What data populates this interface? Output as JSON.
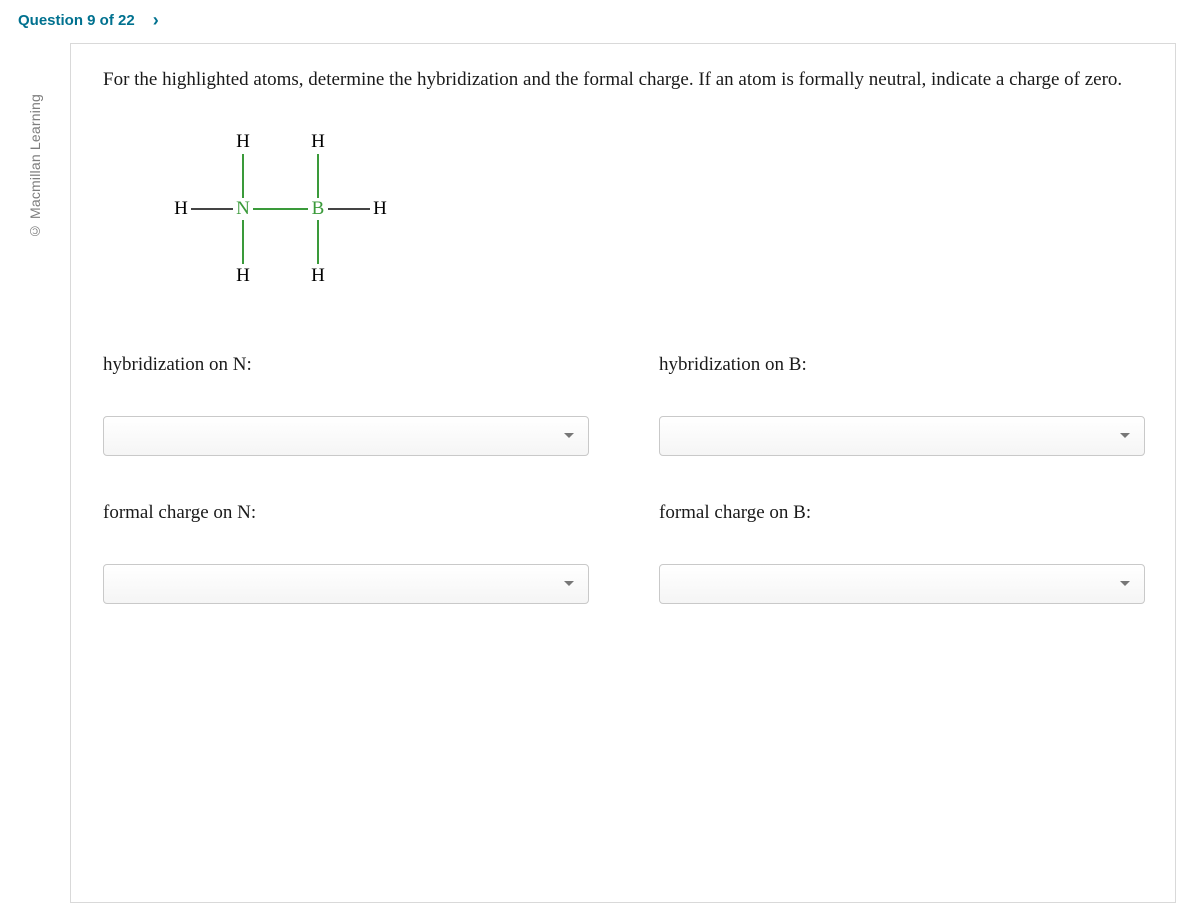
{
  "header": {
    "question_label": "Question 9 of 22",
    "chevron": "›"
  },
  "copyright": "© Macmillan Learning",
  "prompt": "For the highlighted atoms, determine the hybridization and the formal charge. If an atom is formally neutral, indicate a charge of zero.",
  "molecule": {
    "atoms": {
      "H_left": "H",
      "H_topN": "H",
      "H_botN": "H",
      "N_center": "N",
      "B_center": "B",
      "H_topB": "H",
      "H_botB": "H",
      "H_right": "H"
    }
  },
  "fields": {
    "hybN": {
      "label": "hybridization on N:",
      "value": ""
    },
    "hybB": {
      "label": "hybridization on B:",
      "value": ""
    },
    "fcN": {
      "label": "formal charge on N:",
      "value": ""
    },
    "fcB": {
      "label": "formal charge on B:",
      "value": ""
    }
  }
}
